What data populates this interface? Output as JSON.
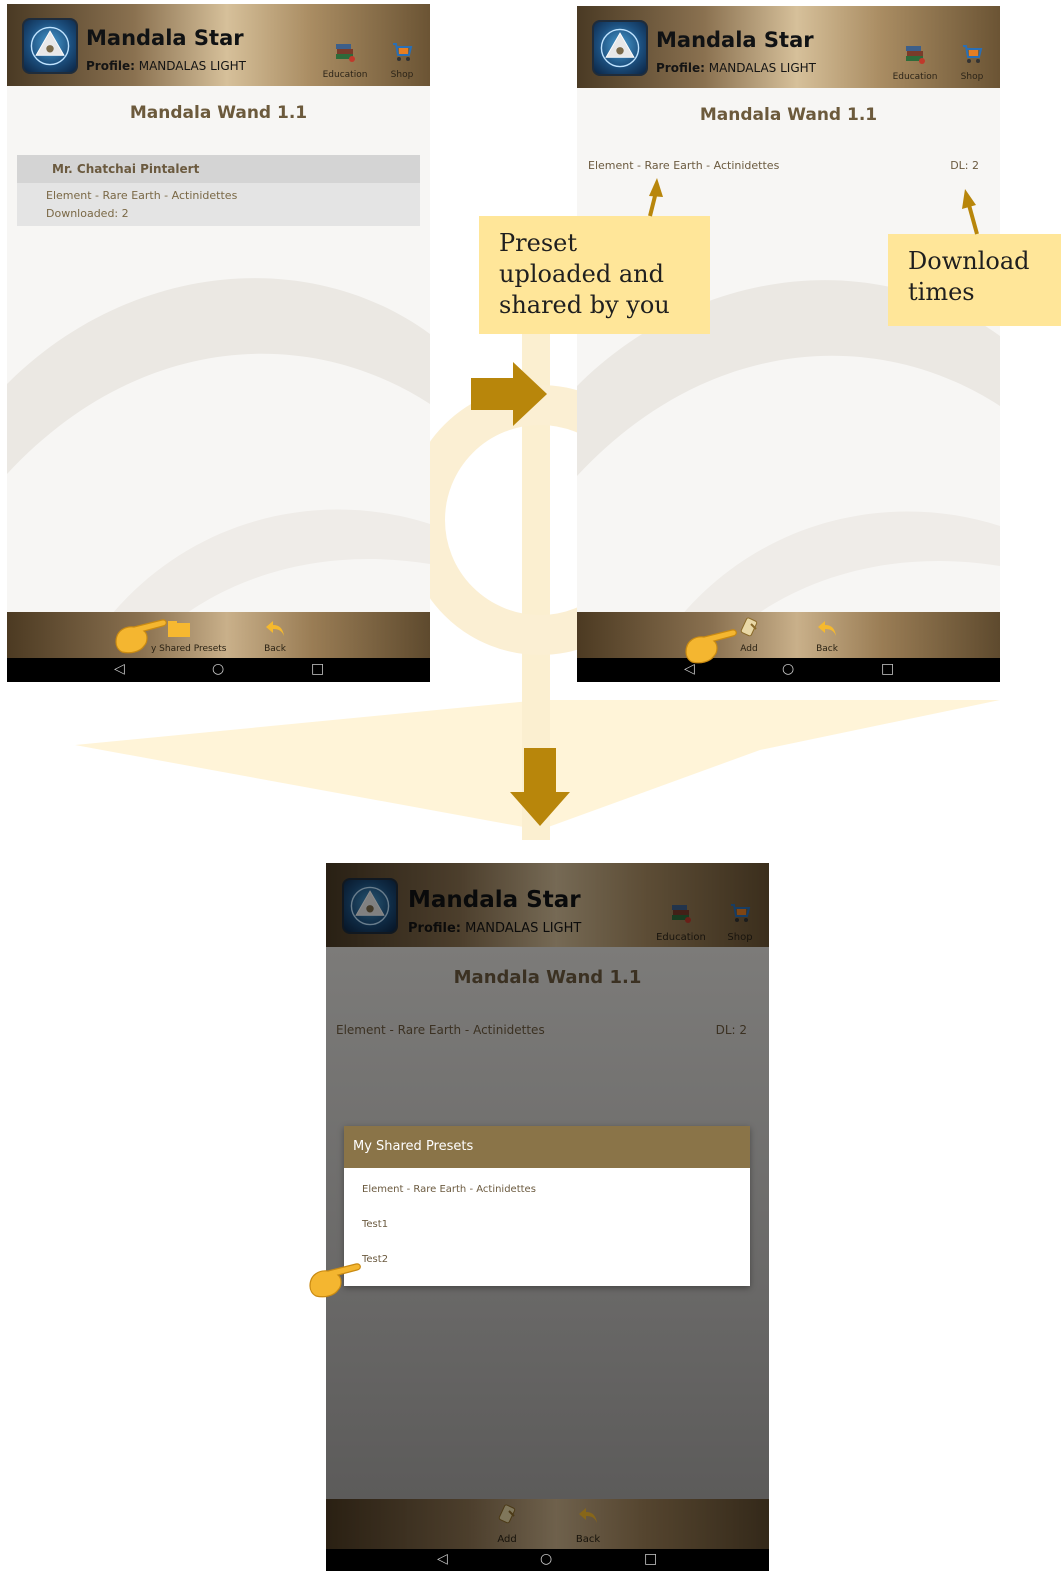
{
  "app": {
    "name": "Mandala Star",
    "profile_label": "Profile:",
    "profile_value": "MANDALAS LIGHT",
    "education_label": "Education",
    "shop_label": "Shop",
    "page_title": "Mandala Wand 1.1"
  },
  "screen1": {
    "group_header": "Mr. Chatchai Pintalert",
    "preset_name": "Element - Rare Earth - Actinidettes",
    "downloaded_text": "Downloaded: 2",
    "footer_button": "My Shared Presets",
    "footer_button_visible": "y Shared Presets",
    "back_label": "Back"
  },
  "screen2": {
    "preset_name": "Element - Rare Earth - Actinidettes",
    "download_count": "DL: 2",
    "add_label": "Add",
    "back_label": "Back"
  },
  "screen3": {
    "preset_name": "Element - Rare Earth - Actinidettes",
    "download_count": "DL: 2",
    "dialog_title": "My Shared Presets",
    "dialog_items": [
      "Element - Rare Earth - Actinidettes",
      "Test1",
      "Test2"
    ],
    "add_label": "Add",
    "back_label": "Back"
  },
  "annotations": {
    "callout_preset": "Preset uploaded and shared by you",
    "callout_download": "Download times"
  },
  "colors": {
    "accent_gold": "#b8860b",
    "callout_bg": "#ffe699",
    "title_brown": "#6c5a3c",
    "dialog_header": "#8a7448"
  },
  "icons": [
    "logo-icon",
    "education-icon",
    "shop-icon",
    "folder-icon",
    "back-icon",
    "add-icon",
    "pointing-hand-icon",
    "nav-back-icon",
    "nav-home-icon",
    "nav-recents-icon",
    "right-arrow-icon",
    "down-arrow-icon"
  ]
}
